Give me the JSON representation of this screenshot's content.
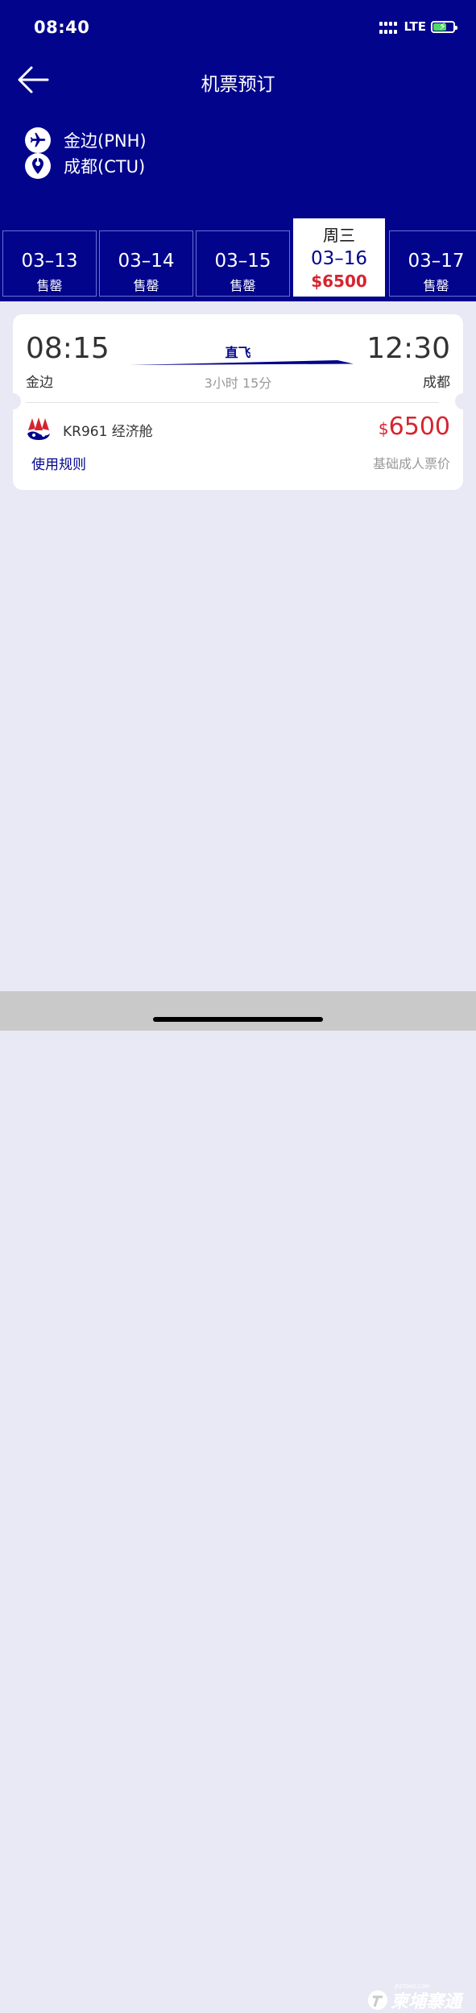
{
  "status_bar": {
    "time": "08:40",
    "network": "LTE"
  },
  "header": {
    "title": "机票预订"
  },
  "route": {
    "origin": "金边(PNH)",
    "destination": "成都(CTU)"
  },
  "date_tabs": [
    {
      "date": "03–13",
      "status": "售罄"
    },
    {
      "date": "03–14",
      "status": "售罄"
    },
    {
      "date": "03–15",
      "status": "售罄"
    },
    {
      "weekday": "周三",
      "date": "03–16",
      "price": "$6500",
      "active": true
    },
    {
      "date": "03–17",
      "status": "售罄"
    }
  ],
  "flight_card": {
    "dep_time": "08:15",
    "dep_city": "金边",
    "arr_time": "12:30",
    "arr_city": "成都",
    "direct_label": "直飞",
    "duration": "3小时 15分",
    "flight_info": "KR961 经济舱",
    "currency": "$",
    "price": "6500",
    "rules_label": "使用规则",
    "fare_note": "基础成人票价"
  },
  "watermark": {
    "text": "柬埔寨通",
    "small": "JPZTONG.COM"
  },
  "colors": {
    "brand": "#02058c",
    "price_red": "#d6242f",
    "background": "#e9e9f5"
  }
}
